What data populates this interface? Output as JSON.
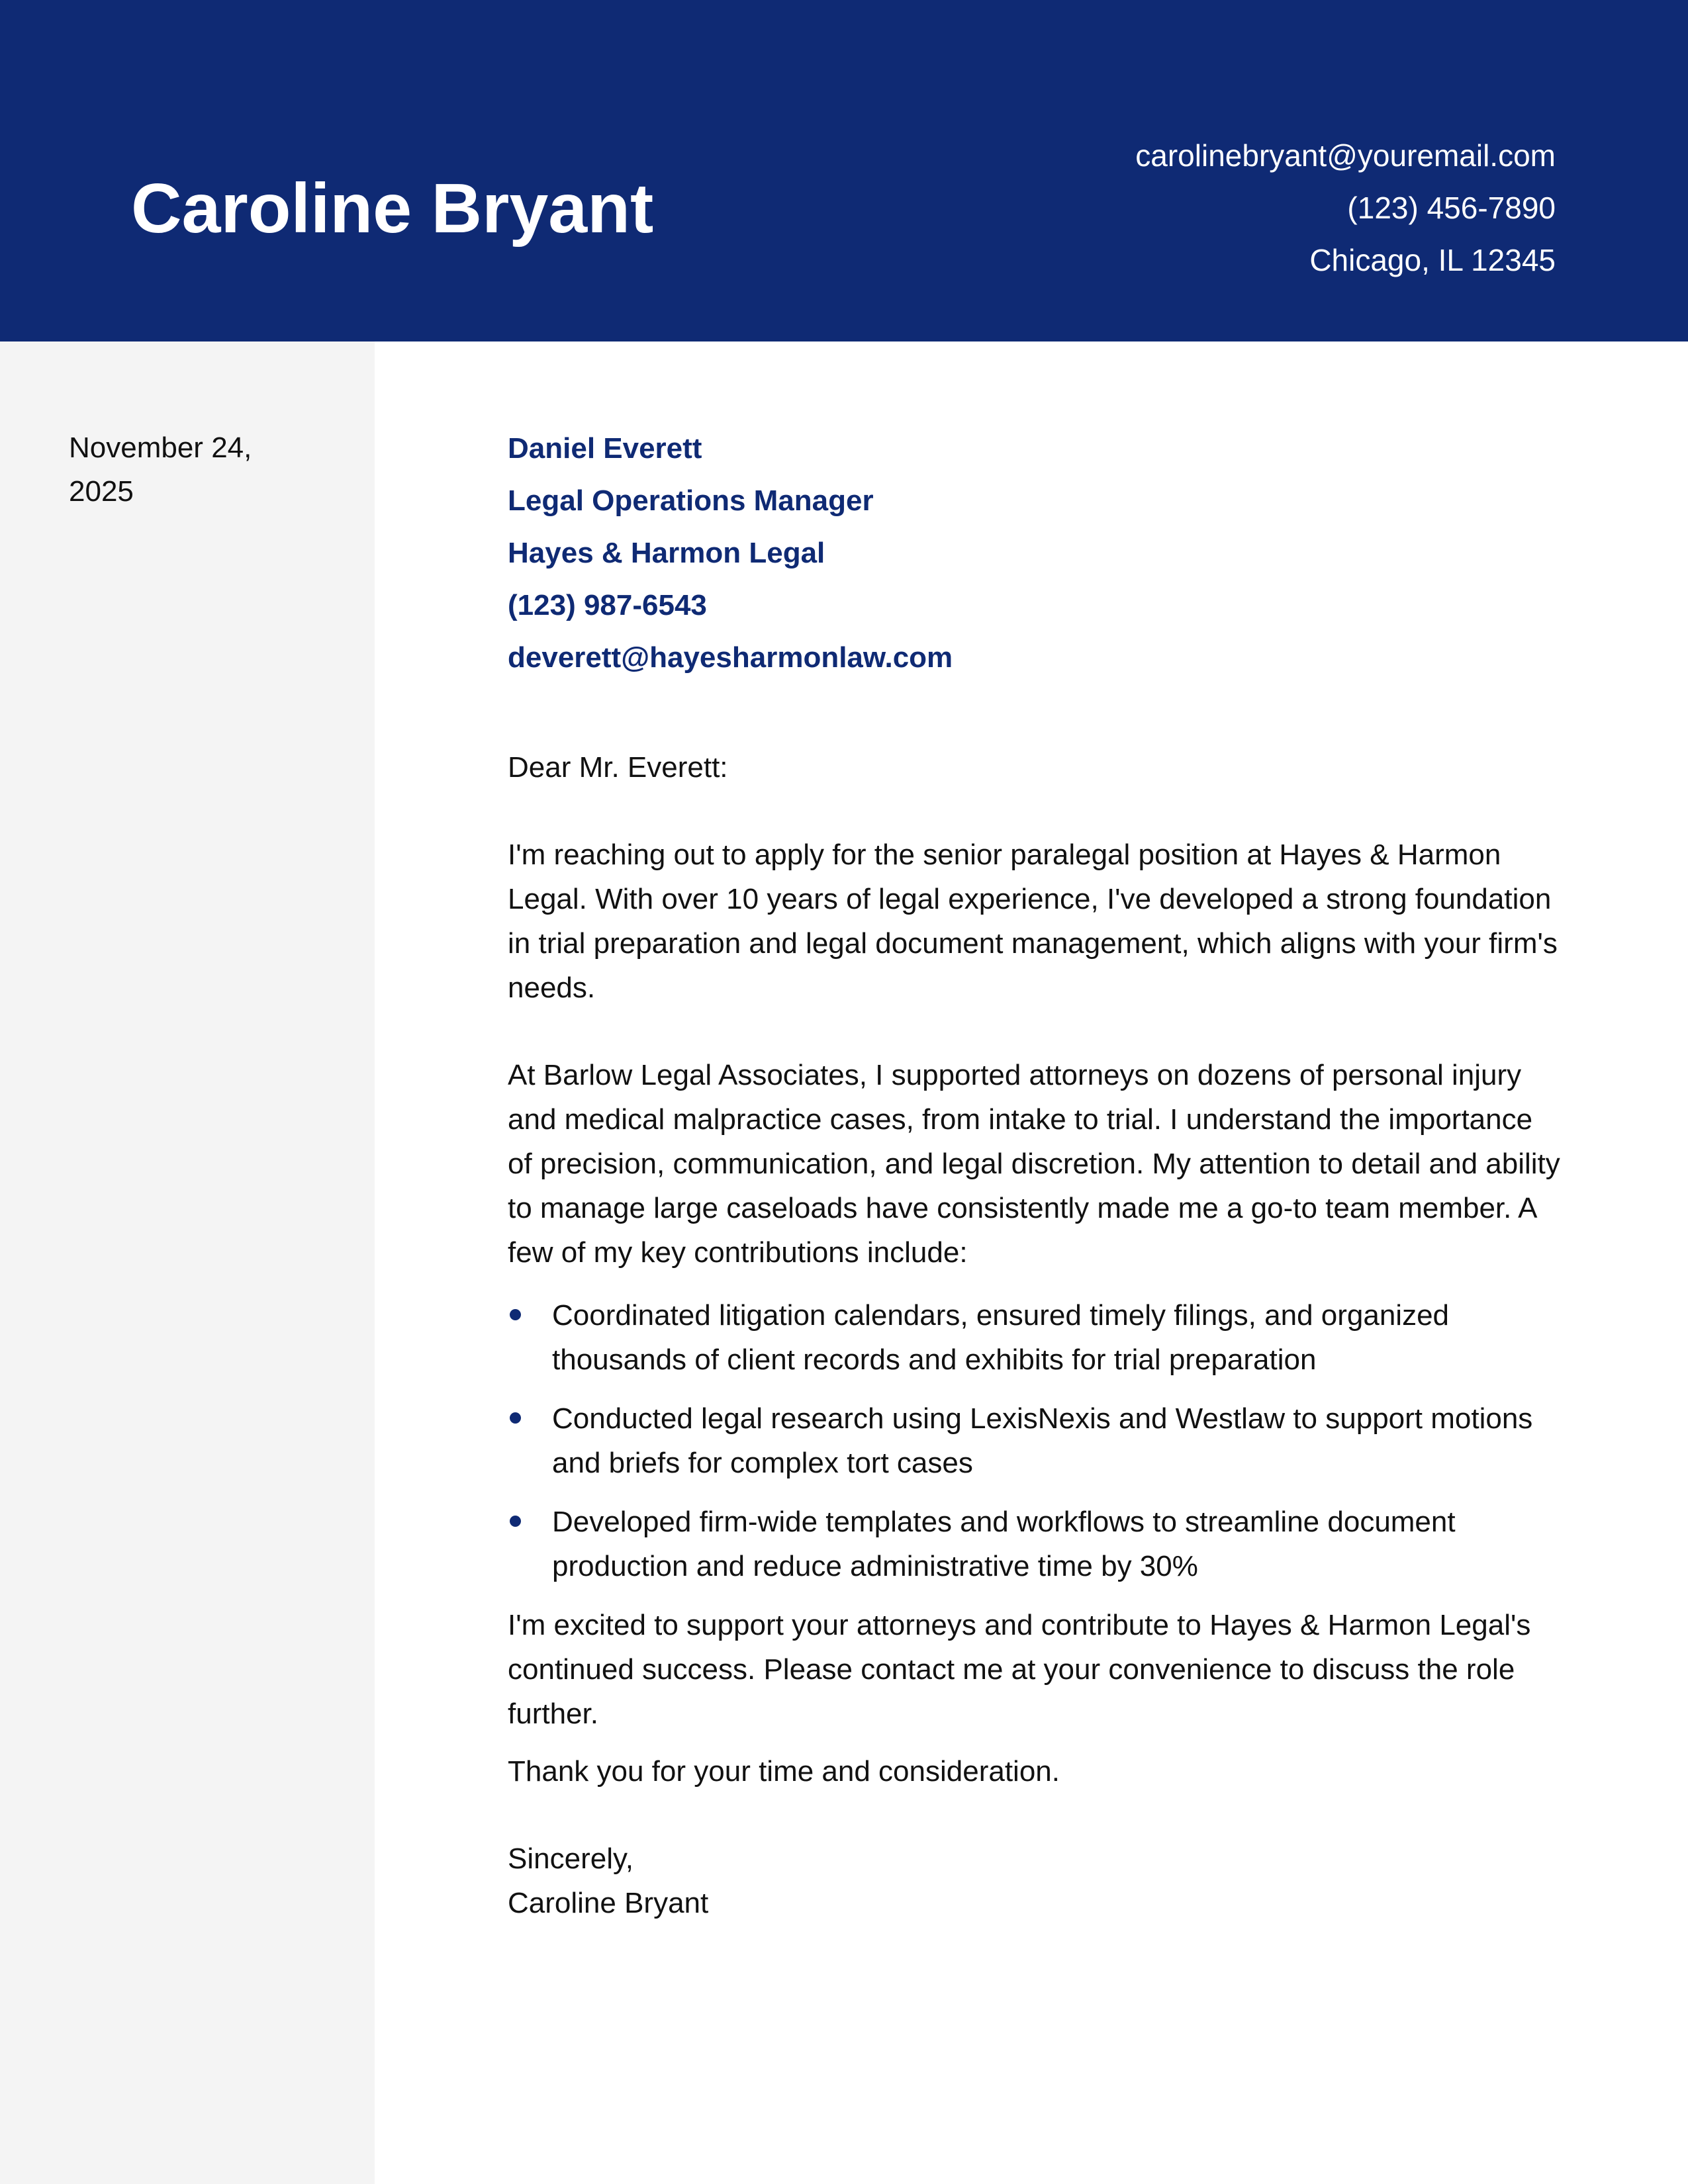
{
  "header": {
    "name": "Caroline Bryant",
    "email": "carolinebryant@youremail.com",
    "phone": "(123) 456-7890",
    "location": "Chicago, IL 12345"
  },
  "sidebar": {
    "date": "November 24, 2025"
  },
  "recipient": {
    "name": "Daniel Everett",
    "title": "Legal Operations Manager",
    "company": "Hayes & Harmon Legal",
    "phone": "(123) 987-6543",
    "email": "deverett@hayesharmonlaw.com"
  },
  "letter": {
    "greeting": "Dear Mr. Everett:",
    "paragraph_1": "I'm reaching out to apply for the senior paralegal position at Hayes & Harmon Legal. With over 10 years of legal experience, I've developed a strong foundation in trial preparation and legal document management, which aligns with your firm's needs.",
    "paragraph_2": "At Barlow Legal Associates, I supported attorneys on dozens of personal injury and medical malpractice cases, from intake to trial. I understand the importance of precision, communication, and legal discretion. My attention to detail and ability to manage large caseloads have consistently made me a go-to team member. A few of my key contributions include:",
    "bullets": [
      "Coordinated litigation calendars, ensured timely filings, and organized thousands of client records and exhibits for trial preparation",
      "Conducted legal research using LexisNexis and Westlaw to support motions and briefs for complex tort cases",
      "Developed firm-wide templates and workflows to streamline document production and reduce administrative time by 30%"
    ],
    "paragraph_3": "I'm excited to support your attorneys and contribute to Hayes & Harmon Legal's continued success. Please contact me at your convenience to discuss the role further.",
    "thanks": "Thank you for your time and consideration.",
    "signoff": "Sincerely,",
    "signature": "Caroline Bryant"
  },
  "colors": {
    "accent": "#0f2a74",
    "sidebar_bg": "#f4f4f4"
  }
}
